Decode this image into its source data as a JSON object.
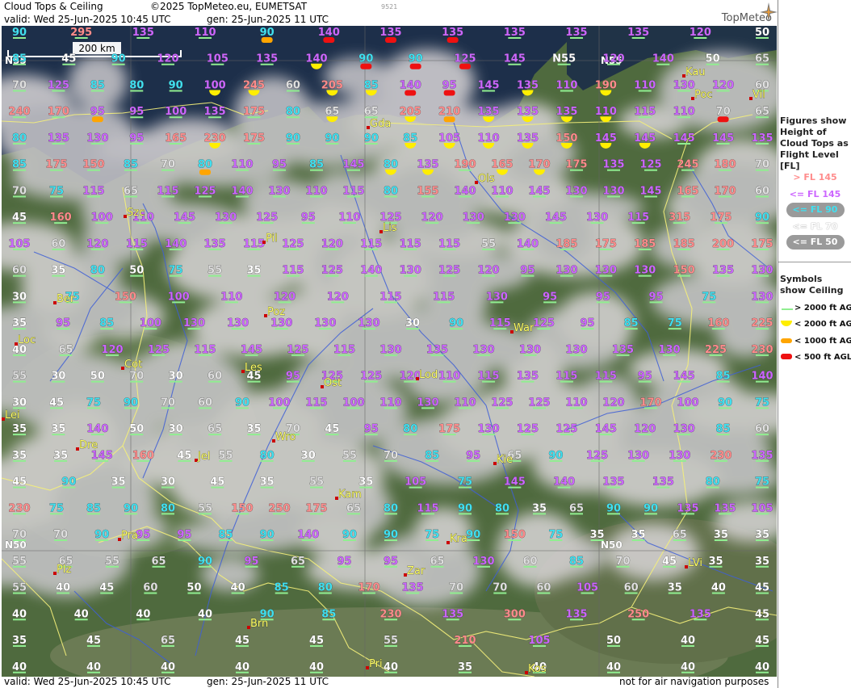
{
  "header": {
    "title": "Cloud Tops & Ceiling",
    "copyright": "©2025 TopMeteo.eu, EUMETSAT",
    "code": "9521",
    "valid": "valid:  Wed  25-Jun-2025  10:45 UTC",
    "gen": "gen:  25-Jun-2025 11 UTC",
    "brand": "TopMeteo"
  },
  "footer": {
    "valid": "valid:  Wed  25-Jun-2025  10:45 UTC",
    "gen": "gen:  25-Jun-2025 11 UTC",
    "disclaimer": "not for air navigation purposes"
  },
  "scale": "200 km",
  "grid_labels": [
    "N55",
    "N55",
    "N50",
    "N50"
  ],
  "colors": {
    "high": "#ff8c8c",
    "mid": "#cc66ff",
    "low90": "#40e0f0",
    "low70": "#e0e0e0",
    "low50": "#ffffff",
    "sym_gt2000": "#90ee90",
    "sym_lt2000": "#ffee00",
    "sym_lt1000": "#ffa500",
    "sym_lt500": "#ee1111"
  },
  "legend": {
    "fig_title": "Figures show Height of Cloud Tops as Flight Level  [FL]",
    "levels": [
      "> FL 145",
      "<= FL 145",
      "<= FL 90",
      "<= FL 70",
      "<= FL 50"
    ],
    "sym_title": "Symbols show Ceiling",
    "symbols": [
      "> 2000 ft AGL",
      "< 2000 ft AGL",
      "< 1000 ft AGL",
      "< 500 ft AGL"
    ]
  },
  "cities": [
    "Kau",
    "Vil",
    "Poc",
    "Gda",
    "Ols",
    "Lis",
    "Szc",
    "Pil",
    "Ber",
    "Poz",
    "War",
    "Loc",
    "Cot",
    "Les",
    "Ost",
    "Lod",
    "Lei",
    "Dre",
    "Wro",
    "Jel",
    "Kie",
    "Kam",
    "Pra",
    "Kra",
    "Plz",
    "Zar",
    "LVi",
    "Brn",
    "Pri",
    "Kos"
  ],
  "rows": [
    [
      "90",
      "295",
      "135",
      "110",
      "90",
      "140",
      "135",
      "135",
      "135",
      "135",
      "135",
      "120",
      "50"
    ],
    [
      "85",
      "45",
      "90",
      "120",
      "105",
      "135",
      "140",
      "90",
      "90",
      "125",
      "145",
      "N55",
      "120",
      "140",
      "50",
      "65"
    ],
    [
      "70",
      "125",
      "85",
      "80",
      "90",
      "100",
      "245",
      "60",
      "205",
      "85",
      "140",
      "95",
      "145",
      "135",
      "110",
      "190",
      "110",
      "130",
      "120",
      "60"
    ],
    [
      "240",
      "170",
      "95",
      "95",
      "100",
      "135",
      "175",
      "80",
      "65",
      "65",
      "205",
      "210",
      "135",
      "135",
      "135",
      "110",
      "115",
      "110",
      "70",
      "65"
    ],
    [
      "80",
      "135",
      "130",
      "95",
      "165",
      "230",
      "175",
      "90",
      "90",
      "90",
      "85",
      "105",
      "110",
      "135",
      "150",
      "145",
      "145",
      "145",
      "145",
      "135"
    ],
    [
      "85",
      "175",
      "150",
      "85",
      "70",
      "80",
      "110",
      "95",
      "85",
      "145",
      "80",
      "135",
      "190",
      "165",
      "170",
      "175",
      "135",
      "125",
      "245",
      "180",
      "70"
    ],
    [
      "70",
      "75",
      "115",
      "65",
      "115",
      "125",
      "140",
      "130",
      "110",
      "115",
      "80",
      "155",
      "140",
      "110",
      "145",
      "130",
      "130",
      "145",
      "165",
      "170",
      "60"
    ],
    [
      "45",
      "160",
      "100",
      "110",
      "145",
      "130",
      "125",
      "95",
      "110",
      "125",
      "120",
      "130",
      "130",
      "145",
      "130",
      "115",
      "315",
      "175",
      "90"
    ],
    [
      "105",
      "60",
      "120",
      "115",
      "140",
      "135",
      "115",
      "125",
      "120",
      "115",
      "115",
      "115",
      "55",
      "140",
      "185",
      "175",
      "185",
      "185",
      "200",
      "175"
    ],
    [
      "60",
      "35",
      "80",
      "50",
      "75",
      "55",
      "35",
      "115",
      "125",
      "140",
      "130",
      "125",
      "120",
      "95",
      "130",
      "130",
      "130",
      "150",
      "135",
      "130"
    ],
    [
      "30",
      "75",
      "150",
      "100",
      "110",
      "120",
      "120",
      "115",
      "115",
      "130",
      "95",
      "95",
      "95",
      "75",
      "130"
    ],
    [
      "35",
      "95",
      "85",
      "100",
      "130",
      "130",
      "130",
      "130",
      "130",
      "30",
      "90",
      "115",
      "125",
      "95",
      "85",
      "75",
      "160",
      "225"
    ],
    [
      "40",
      "65",
      "120",
      "125",
      "115",
      "145",
      "125",
      "115",
      "130",
      "135",
      "130",
      "130",
      "130",
      "135",
      "130",
      "225",
      "230"
    ],
    [
      "55",
      "30",
      "50",
      "70",
      "30",
      "60",
      "45",
      "95",
      "125",
      "125",
      "120",
      "110",
      "115",
      "135",
      "115",
      "115",
      "95",
      "145",
      "85",
      "140"
    ],
    [
      "30",
      "45",
      "75",
      "90",
      "70",
      "60",
      "90",
      "100",
      "115",
      "100",
      "110",
      "130",
      "110",
      "125",
      "125",
      "110",
      "120",
      "170",
      "100",
      "90",
      "75"
    ],
    [
      "35",
      "35",
      "140",
      "50",
      "30",
      "65",
      "35",
      "70",
      "45",
      "95",
      "80",
      "175",
      "130",
      "125",
      "125",
      "145",
      "120",
      "130",
      "85",
      "60"
    ],
    [
      "35",
      "35",
      "145",
      "160",
      "45",
      "55",
      "80",
      "30",
      "55",
      "70",
      "85",
      "95",
      "65",
      "90",
      "125",
      "130",
      "130",
      "230",
      "135"
    ],
    [
      "45",
      "90",
      "35",
      "30",
      "45",
      "35",
      "55",
      "35",
      "105",
      "75",
      "145",
      "140",
      "135",
      "135",
      "80",
      "75"
    ],
    [
      "230",
      "75",
      "85",
      "90",
      "80",
      "55",
      "150",
      "250",
      "175",
      "65",
      "80",
      "115",
      "90",
      "80",
      "35",
      "65",
      "90",
      "90",
      "135",
      "135",
      "105"
    ],
    [
      "70",
      "70",
      "90",
      "95",
      "95",
      "85",
      "90",
      "140",
      "90",
      "90",
      "75",
      "90",
      "150",
      "75",
      "35",
      "35",
      "65",
      "35",
      "35"
    ],
    [
      "55",
      "65",
      "55",
      "65",
      "90",
      "95",
      "65",
      "95",
      "95",
      "65",
      "130",
      "60",
      "85",
      "70",
      "45",
      "35",
      "35"
    ],
    [
      "55",
      "40",
      "45",
      "60",
      "50",
      "40",
      "85",
      "80",
      "170",
      "135",
      "70",
      "70",
      "60",
      "105",
      "60",
      "35",
      "40",
      "45"
    ],
    [
      "40",
      "40",
      "40",
      "40",
      "90",
      "85",
      "230",
      "135",
      "300",
      "135",
      "250",
      "135",
      "45"
    ],
    [
      "35",
      "45",
      "65",
      "45",
      "45",
      "55",
      "210",
      "105",
      "50",
      "40",
      "45"
    ],
    [
      "40",
      "40",
      "40",
      "40",
      "40",
      "40",
      "35",
      "40",
      "40",
      "40",
      "40"
    ]
  ]
}
